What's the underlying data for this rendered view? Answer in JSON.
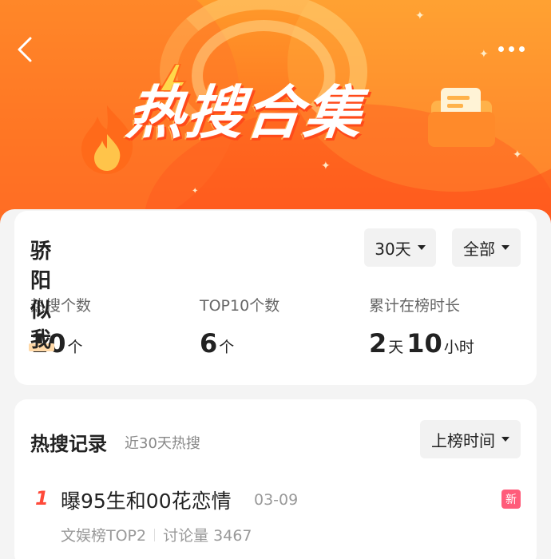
{
  "banner": {
    "title": "热搜合集",
    "back_icon": "chevron-left-icon",
    "more_icon": "more-dots-icon",
    "colors": {
      "top": "#ff9a2a",
      "bottom": "#ff5a1e"
    }
  },
  "summary": {
    "name": "骄阳似我",
    "period_dropdown": "30天",
    "scope_dropdown": "全部",
    "stats": [
      {
        "label": "热搜个数",
        "value": "10",
        "unit": "个"
      },
      {
        "label": "TOP10个数",
        "value": "6",
        "unit": "个"
      },
      {
        "label": "累计在榜时长",
        "days": "2",
        "days_unit": "天",
        "hours": "10",
        "hours_unit": "小时"
      }
    ]
  },
  "records": {
    "title": "热搜记录",
    "subtitle": "近30天热搜",
    "sort_dropdown": "上榜时间",
    "items": [
      {
        "rank": "1",
        "title": "曝95生和00花恋情",
        "date": "03-09",
        "badge": "新",
        "board": "文娱榜TOP2",
        "discussion": "讨论量 3467"
      }
    ]
  },
  "accent_color": "#ff4a3a",
  "badge_color": "#ff5c7a"
}
